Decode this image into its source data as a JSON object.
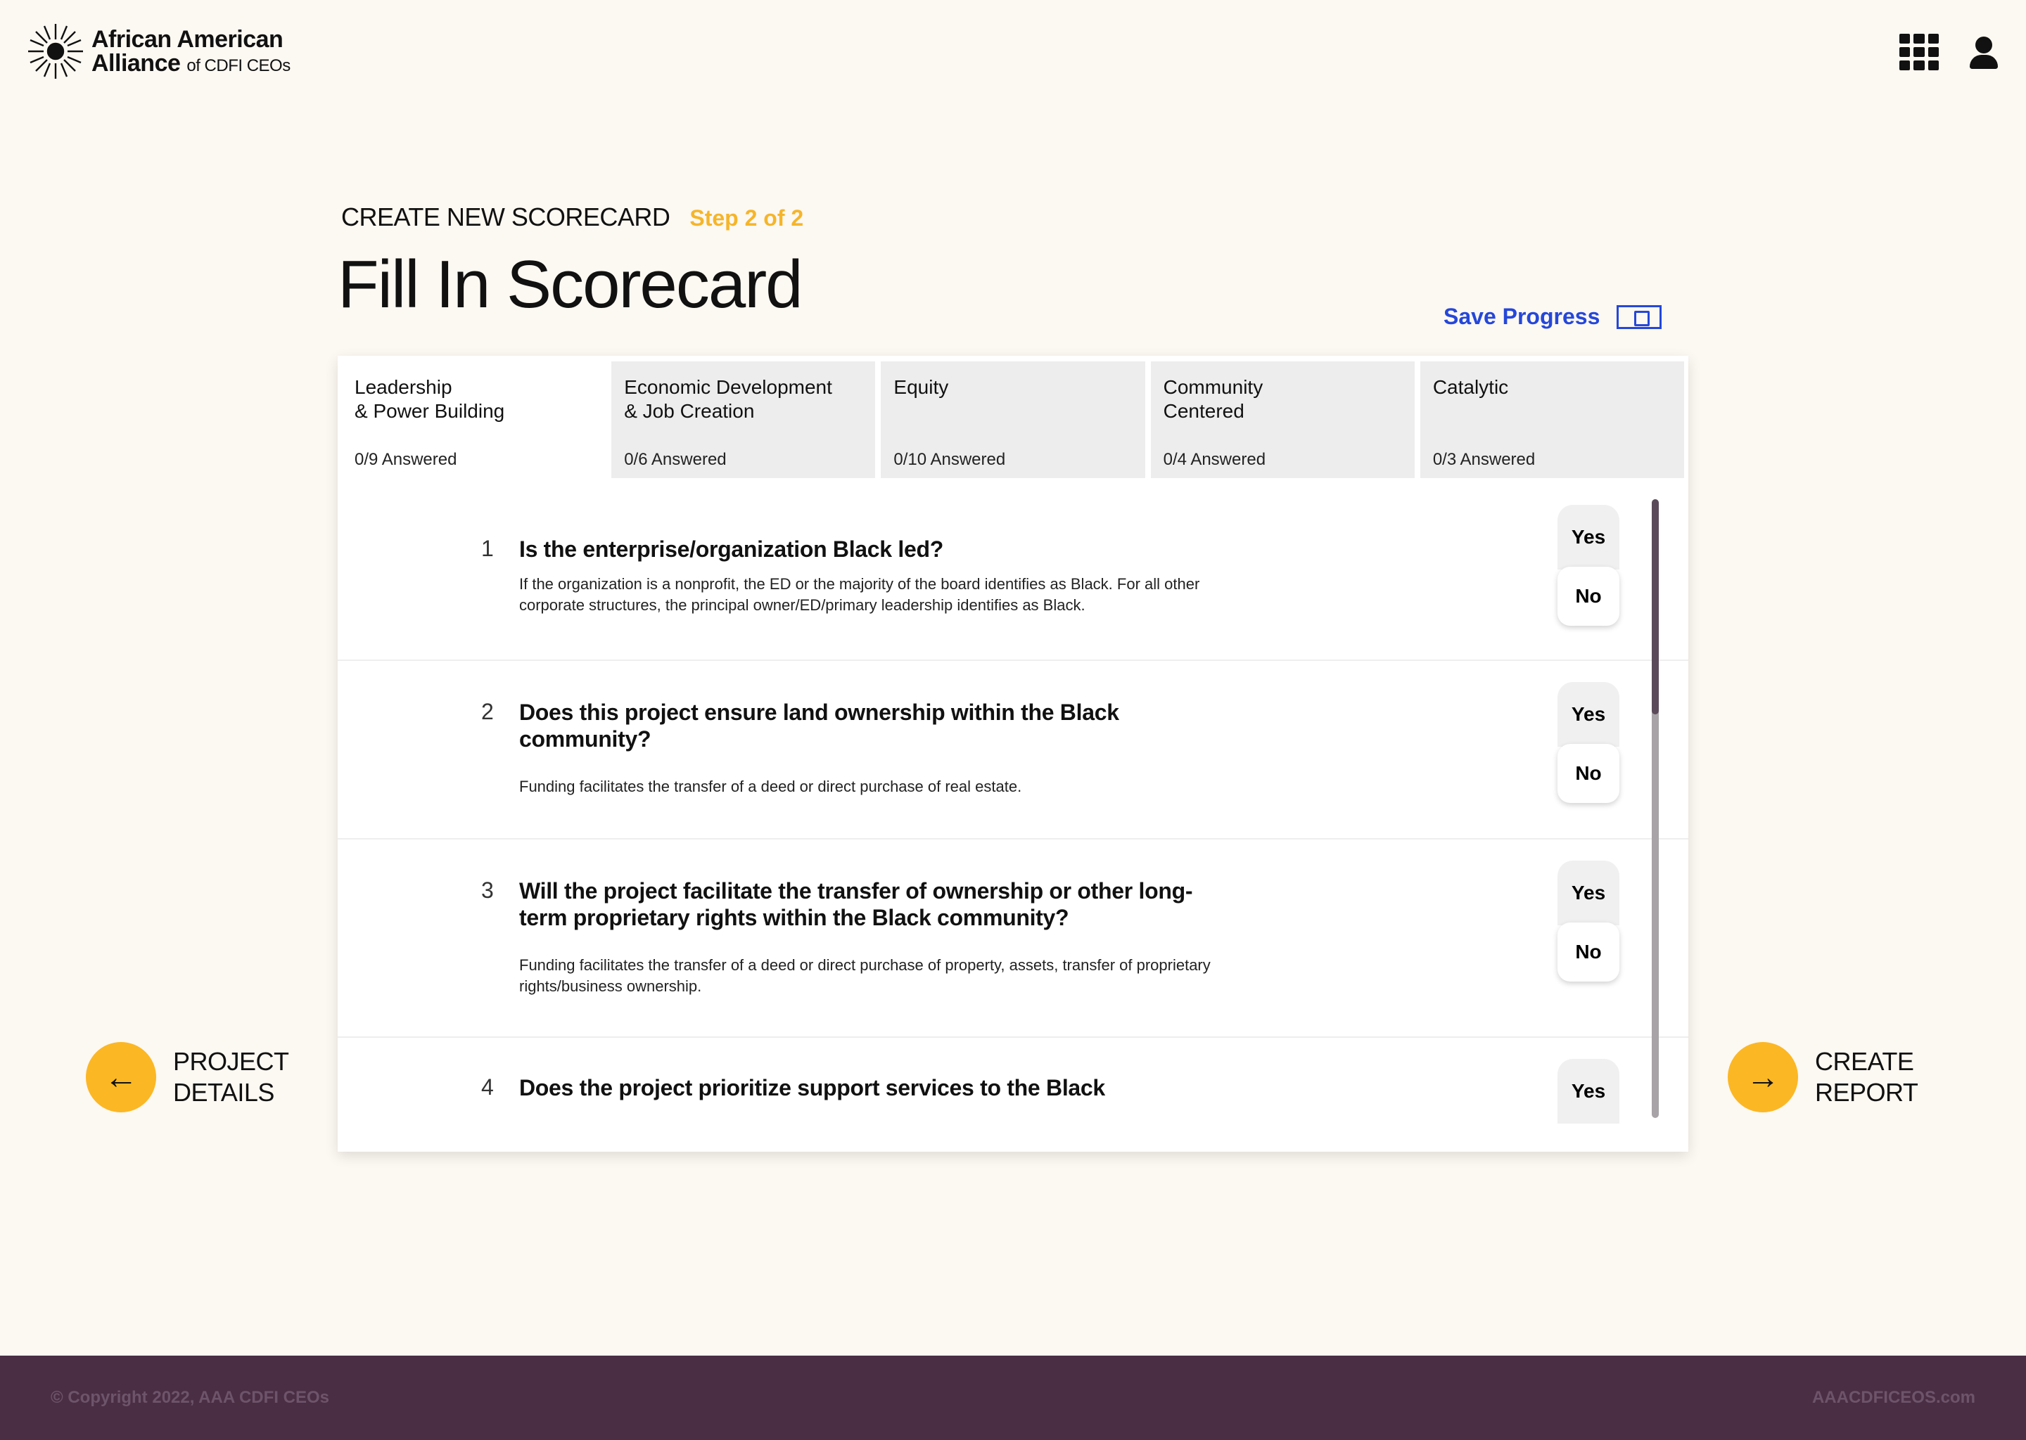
{
  "header": {
    "logo_line1": "African American",
    "logo_line2_main": "Alliance",
    "logo_line2_small": "of CDFI CEOs",
    "apps_icon": "grid-icon",
    "account_icon": "user-icon"
  },
  "breadcrumb": {
    "title": "CREATE NEW SCORECARD",
    "step": "Step 2 of 2"
  },
  "page": {
    "title": "Fill In Scorecard",
    "save_label": "Save Progress",
    "save_icon": "save-icon"
  },
  "tabs": [
    {
      "label": "Leadership\n& Power Building",
      "count": "0/9 Answered",
      "active": true
    },
    {
      "label": "Economic Development\n& Job Creation",
      "count": "0/6 Answered",
      "active": false
    },
    {
      "label": "Equity",
      "count": "0/10 Answered",
      "active": false
    },
    {
      "label": "Community\nCentered",
      "count": "0/4 Answered",
      "active": false
    },
    {
      "label": "Catalytic",
      "count": "0/3 Answered",
      "active": false
    }
  ],
  "questions": [
    {
      "num": "1",
      "title": "Is the enterprise/organization Black led?",
      "description": "If the organization is a nonprofit, the ED or the majority of the board identifies as Black. For all other corporate structures, the principal owner/ED/primary leadership identifies as Black.",
      "yes": "Yes",
      "no": "No"
    },
    {
      "num": "2",
      "title": "Does this project ensure land ownership within the Black community?",
      "description": "Funding facilitates the transfer of a deed or direct purchase of real estate.",
      "yes": "Yes",
      "no": "No"
    },
    {
      "num": "3",
      "title": "Will the project facilitate the transfer of ownership or other long-term proprietary rights within the Black community?",
      "description": "Funding facilitates the transfer of a deed or direct purchase of property, assets, transfer of proprietary rights/business ownership.",
      "yes": "Yes",
      "no": "No"
    },
    {
      "num": "4",
      "title": "Does the project prioritize support services to the Black community in a way that fosters sustained leadership.",
      "yes": "Yes"
    }
  ],
  "nav": {
    "prev_label": "PROJECT\nDETAILS",
    "next_label": "CREATE\nREPORT",
    "prev_icon": "arrow-left-icon",
    "next_icon": "arrow-right-icon"
  },
  "footer": {
    "copyright": "© Copyright 2022, AAA CDFI CEOs",
    "site": "AAACDFICEOS.com"
  },
  "colors": {
    "background": "#fcf8f2",
    "accent_yellow": "#fbb724",
    "step_yellow": "#f5b52a",
    "link_blue": "#2547d9",
    "footer_purple": "#4a2e44"
  }
}
